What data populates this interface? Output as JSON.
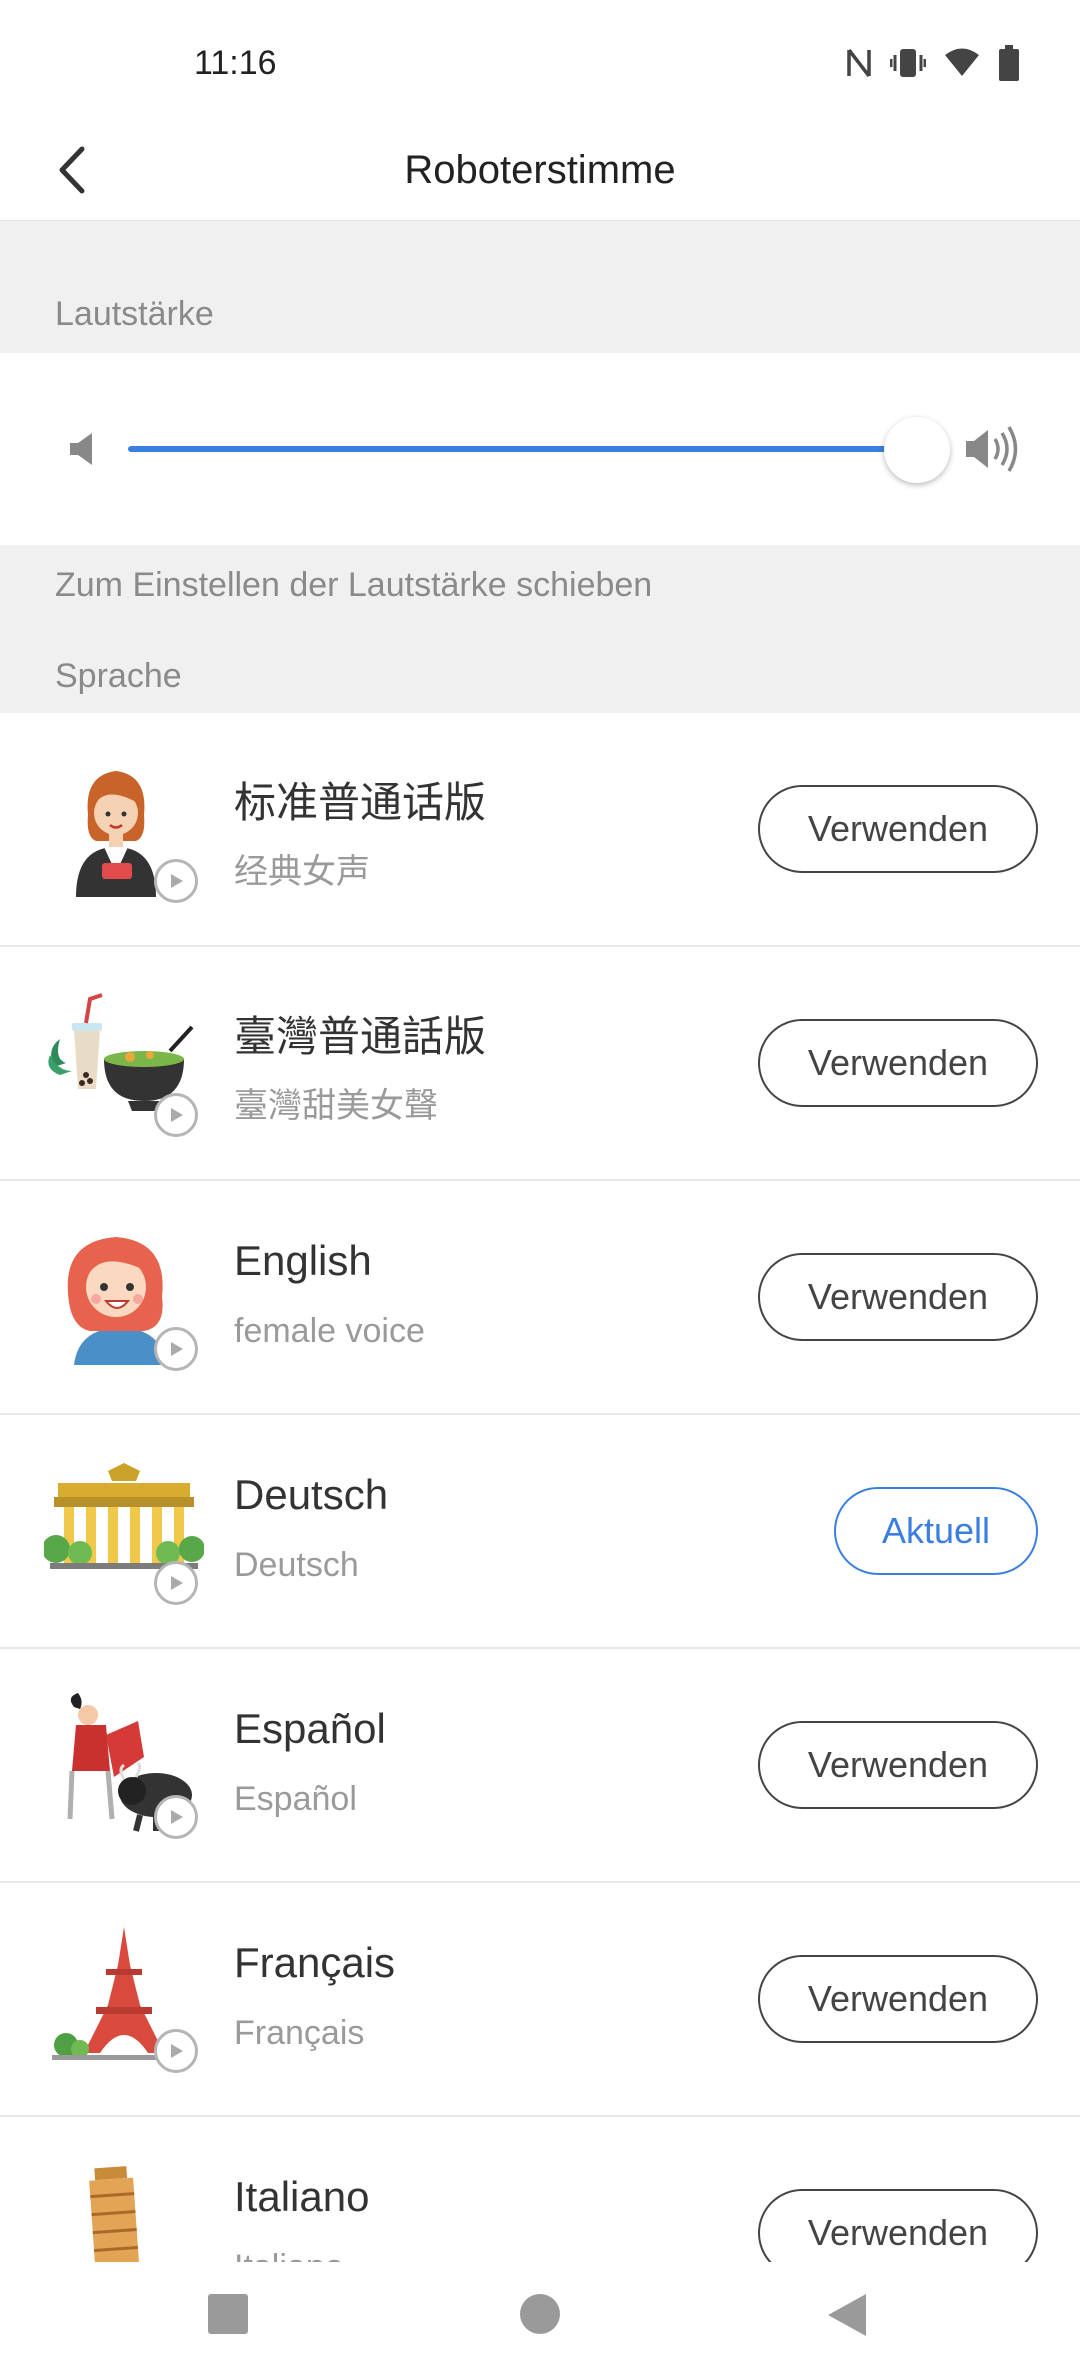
{
  "status": {
    "time": "11:16"
  },
  "header": {
    "title": "Roboterstimme"
  },
  "volume": {
    "section_label": "Lautstärke",
    "level": 0.98,
    "hint": "Zum Einstellen der Lautstärke schieben"
  },
  "language": {
    "section_label": "Sprache"
  },
  "voices": [
    {
      "name": "标准普通话版",
      "sub": "经典女声",
      "button": "Verwenden",
      "icon": "newscaster-icon"
    },
    {
      "name": "臺灣普通話版",
      "sub": "臺灣甜美女聲",
      "button": "Verwenden",
      "icon": "bubble-tea-noodles-icon"
    },
    {
      "name": "English",
      "sub": "female voice",
      "button": "Verwenden",
      "icon": "red-hair-girl-icon"
    },
    {
      "name": "Deutsch",
      "sub": "Deutsch",
      "button": "Aktuell",
      "icon": "brandenburg-gate-icon"
    },
    {
      "name": "Español",
      "sub": "Español",
      "button": "Verwenden",
      "icon": "bullfighter-icon"
    },
    {
      "name": "Français",
      "sub": "Français",
      "button": "Verwenden",
      "icon": "eiffel-tower-icon"
    },
    {
      "name": "Italiano",
      "sub": "Italiano",
      "button": "Verwenden",
      "icon": "leaning-tower-icon"
    }
  ],
  "colors": {
    "accent": "#3a7fe0",
    "band": "#f0f0f0",
    "muted_text": "#8a8a8a"
  }
}
